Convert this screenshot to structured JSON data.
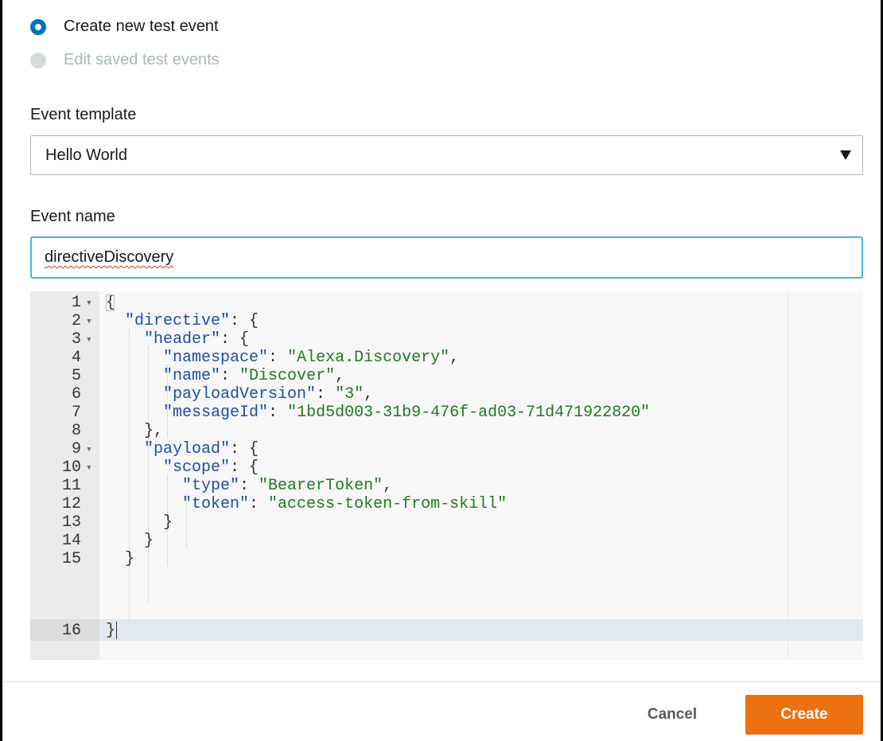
{
  "mode_options": [
    {
      "label": "Create new test event",
      "selected": true
    },
    {
      "label": "Edit saved test events",
      "selected": false
    }
  ],
  "event_template": {
    "label": "Event template",
    "value": "Hello World"
  },
  "event_name": {
    "label": "Event name",
    "value": "directiveDiscovery"
  },
  "editor": {
    "line_numbers": [
      "1",
      "2",
      "3",
      "4",
      "5",
      "6",
      "7",
      "8",
      "9",
      "10",
      "11",
      "12",
      "13",
      "14",
      "15",
      "16"
    ],
    "fold_markers": [
      "▾",
      "▾",
      "▾",
      "",
      "",
      "",
      "",
      "",
      "▾",
      "▾",
      "",
      "",
      "",
      "",
      "",
      ""
    ],
    "lines": [
      "{",
      "  \"directive\": {",
      "    \"header\": {",
      "      \"namespace\": \"Alexa.Discovery\",",
      "      \"name\": \"Discover\",",
      "      \"payloadVersion\": \"3\",",
      "      \"messageId\": \"1bd5d003-31b9-476f-ad03-71d471922820\"",
      "    },",
      "    \"payload\": {",
      "      \"scope\": {",
      "        \"type\": \"BearerToken\",",
      "        \"token\": \"access-token-from-skill\"",
      "      }",
      "    }",
      "  }",
      "}"
    ],
    "active_line": 16
  },
  "buttons": {
    "cancel": "Cancel",
    "create": "Create"
  },
  "colors": {
    "accent_radio": "#0073bb",
    "input_focus": "#44b9d6",
    "primary_button": "#ec7211",
    "json_key": "#1b4fa8",
    "json_string": "#1f7a1f"
  }
}
